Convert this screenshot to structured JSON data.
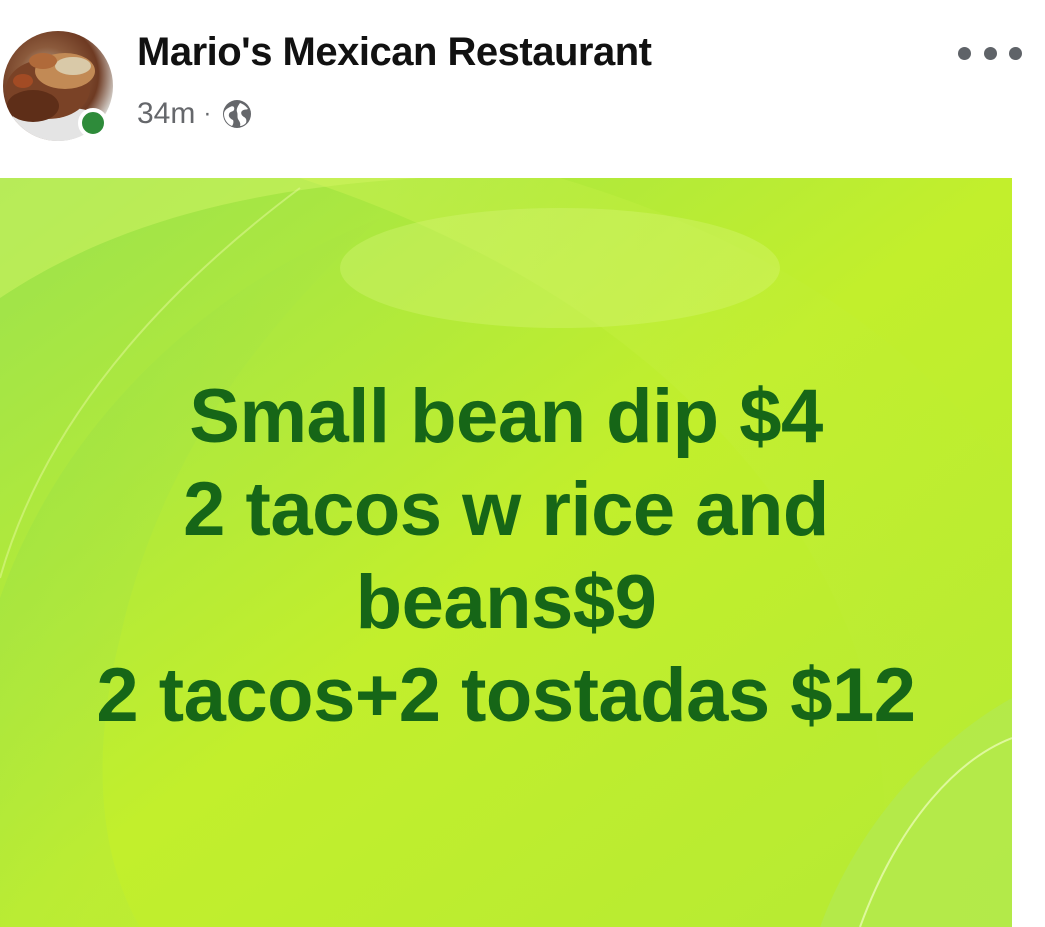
{
  "post": {
    "author": "Mario's Mexican Restaurant",
    "timestamp": "34m",
    "separator": "·",
    "audience_icon": "globe-icon",
    "more_icon": "more-options-icon",
    "author_online": true
  },
  "image": {
    "lines": [
      "Small bean dip $4",
      "2 tacos w rice and",
      "beans$9",
      "2 tacos+2 tostadas $12"
    ]
  },
  "colors": {
    "text_primary": "#111111",
    "text_secondary": "#65676b",
    "online_green": "#2e8b3a",
    "image_text_green": "#166617",
    "image_background": "#b6ec2a"
  }
}
